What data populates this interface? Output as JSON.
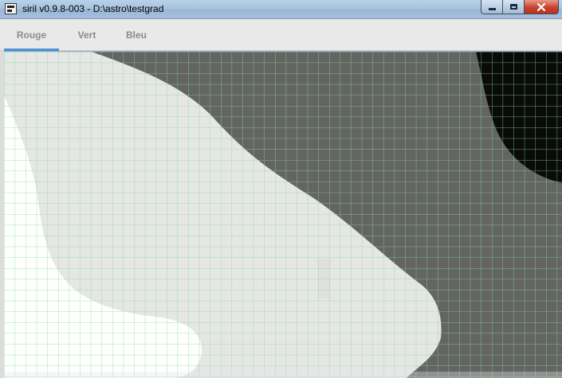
{
  "window": {
    "title": "siril v0.9.8-003 - D:\\astro\\testgrad",
    "controls": [
      "minimize",
      "maximize",
      "close"
    ],
    "icons": {
      "app": "siril-app-icon",
      "minimize": "minimize-icon",
      "maximize": "maximize-icon",
      "close": "close-icon"
    }
  },
  "tabs": [
    {
      "label": "Rouge",
      "active": true
    },
    {
      "label": "Vert",
      "active": false
    },
    {
      "label": "Bleu",
      "active": false
    }
  ],
  "colors": {
    "tab_underline": "#4a90d9",
    "sample_grid": "#7ee08a",
    "background_dark": "#646464",
    "background_black": "#0a0a0a",
    "background_light": "#e6e6e6",
    "background_white": "#ffffff"
  }
}
